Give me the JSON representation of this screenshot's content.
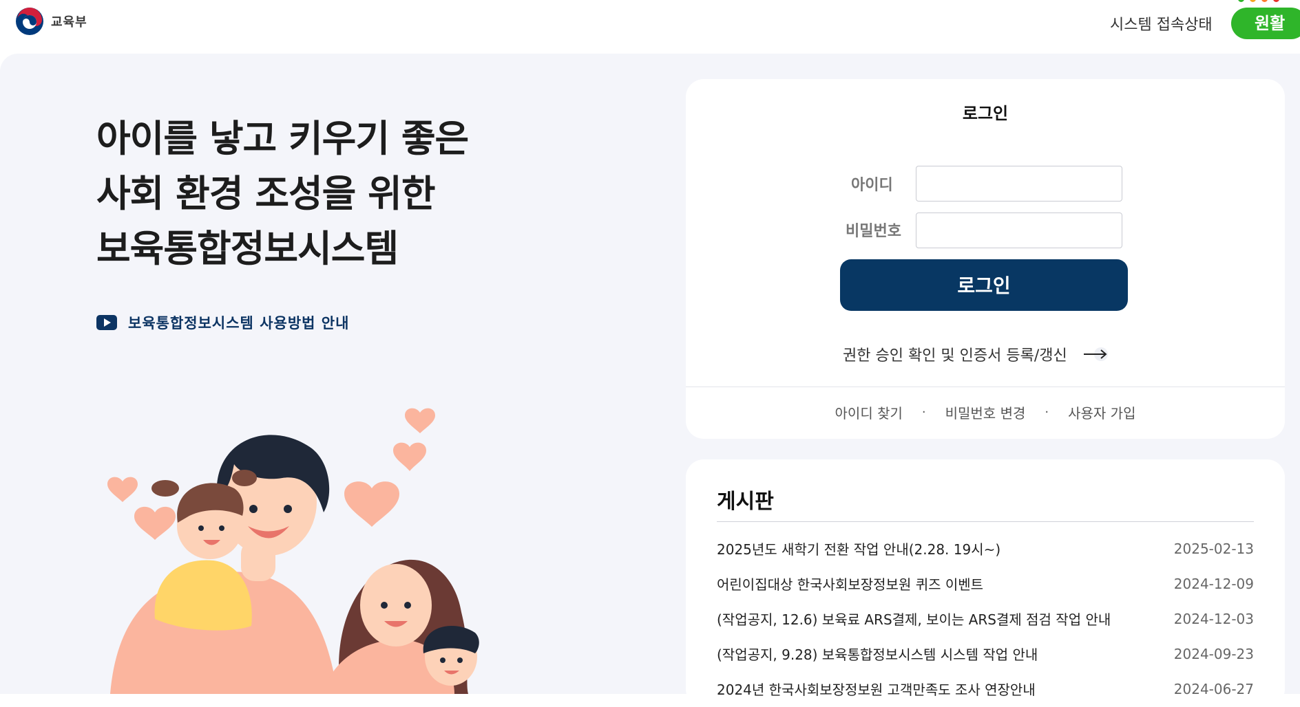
{
  "header": {
    "logo_text": "교육부",
    "status_label": "시스템 접속상태",
    "status_value": "원활",
    "status_color": "#2fb52a",
    "status_dot_colors": [
      "#2fb52a",
      "#f5a623",
      "#ff7a2f",
      "#e8322a"
    ]
  },
  "hero": {
    "title_lines": [
      "아이를 낳고 키우기 좋은",
      "사회 환경 조성을 위한",
      "보육통합정보시스템"
    ],
    "guide_link": "보육통합정보시스템 사용방법 안내"
  },
  "login": {
    "title": "로그인",
    "id_label": "아이디",
    "id_value": "",
    "password_label": "비밀번호",
    "password_value": "",
    "submit_label": "로그인",
    "cert_link": "권한 승인 확인 및 인증서 등록/갱신",
    "links": [
      "아이디 찾기",
      "비밀번호 변경",
      "사용자 가입"
    ],
    "separator": "·"
  },
  "board": {
    "title": "게시판",
    "posts": [
      {
        "title": "2025년도 새학기 전환 작업 안내(2.28. 19시~)",
        "date": "2025-02-13"
      },
      {
        "title": "어린이집대상 한국사회보장정보원 퀴즈 이벤트",
        "date": "2024-12-09"
      },
      {
        "title": "(작업공지, 12.6) 보육료 ARS결제, 보이는 ARS결제 점검 작업 안내",
        "date": "2024-12-03"
      },
      {
        "title": "(작업공지, 9.28) 보육통합정보시스템 시스템 작업 안내",
        "date": "2024-09-23"
      },
      {
        "title": "2024년 한국사회보장정보원 고객만족도 조사 연장안내",
        "date": "2024-06-27"
      }
    ]
  },
  "colors": {
    "primary": "#083763",
    "background": "#f4f5fa",
    "heart": "#fbb59e"
  },
  "icons": [
    "gov-emblem-icon",
    "youtube-play-icon",
    "arrow-right-icon"
  ]
}
